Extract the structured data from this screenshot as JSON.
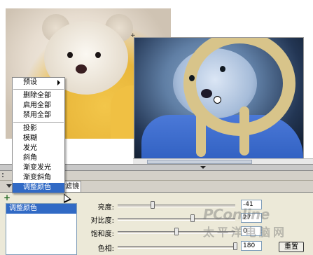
{
  "context_menu": {
    "items": [
      {
        "label": "预设",
        "has_submenu": true
      },
      {
        "separator": true
      },
      {
        "label": "删除全部"
      },
      {
        "label": "启用全部"
      },
      {
        "label": "禁用全部"
      },
      {
        "separator": true
      },
      {
        "label": "投影"
      },
      {
        "label": "模糊"
      },
      {
        "label": "发光"
      },
      {
        "label": "斜角"
      },
      {
        "label": "渐变发光"
      },
      {
        "label": "渐变斜角"
      },
      {
        "label": "调整颜色",
        "selected": true
      }
    ]
  },
  "panel": {
    "tab_label": "滤镜",
    "add_icon": "plus-icon",
    "filter_list": [
      "调整颜色"
    ],
    "params": [
      {
        "label": "亮度:",
        "value": "-41",
        "level": -41,
        "min": -100,
        "max": 100
      },
      {
        "label": "对比度:",
        "value": "27",
        "level": 27,
        "min": -100,
        "max": 100
      },
      {
        "label": "饱和度:",
        "value": "0",
        "level": 0,
        "min": -100,
        "max": 100
      },
      {
        "label": "色相:",
        "value": "180",
        "level": 180,
        "min": -180,
        "max": 180
      }
    ],
    "reset_label": "重置"
  },
  "watermark": {
    "brand": "PConline",
    "cn": "太平洋电脑网"
  },
  "colors": {
    "selection": "#316ac5",
    "panel_bg": "#ece9d8"
  }
}
